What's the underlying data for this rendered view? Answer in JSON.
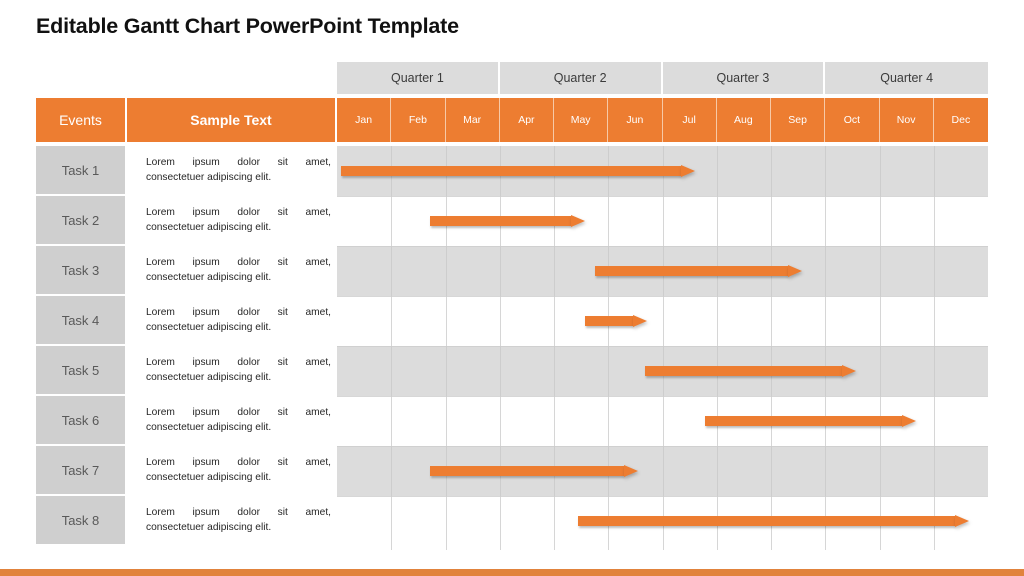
{
  "title": "Editable Gantt Chart PowerPoint Template",
  "headers": {
    "events": "Events",
    "sample_text": "Sample Text"
  },
  "colors": {
    "accent_orange": "#ed7d31",
    "bottom_bar": "#e1833c",
    "row_shaded": "#dcdcdc",
    "row_plain": "#ffffff",
    "task_cell": "#cfcfcf",
    "quarter_header": "#dcdcdc",
    "title_text": "#111111"
  },
  "chart_data": {
    "type": "bar",
    "chart_kind": "gantt",
    "title": "Editable Gantt Chart PowerPoint Template",
    "xlabel": "",
    "ylabel": "",
    "grid": true,
    "legend": "none",
    "quarters": [
      "Quarter 1",
      "Quarter 2",
      "Quarter 3",
      "Quarter 4"
    ],
    "months": [
      "Jan",
      "Feb",
      "Mar",
      "Apr",
      "May",
      "Jun",
      "Jul",
      "Aug",
      "Sep",
      "Oct",
      "Nov",
      "Dec"
    ],
    "xlim": [
      0,
      12
    ],
    "categories": [
      "Task 1",
      "Task 2",
      "Task 3",
      "Task 4",
      "Task 5",
      "Task 6",
      "Task 7",
      "Task 8"
    ],
    "tasks": [
      {
        "name": "Task 1",
        "description": "Lorem ipsum dolor sit amet, consectetuer adipiscing elit.",
        "start_month": 0.08,
        "end_month": 6.6,
        "start_label": "Jan",
        "end_label": "Jul",
        "shaded": true
      },
      {
        "name": "Task 2",
        "description": "Lorem ipsum dolor sit amet, consectetuer adipiscing elit.",
        "start_month": 1.72,
        "end_month": 4.58,
        "start_label": "Feb",
        "end_label": "May",
        "shaded": false
      },
      {
        "name": "Task 3",
        "description": "Lorem ipsum dolor sit amet, consectetuer adipiscing elit.",
        "start_month": 4.75,
        "end_month": 8.58,
        "start_label": "May",
        "end_label": "Sep",
        "shaded": true
      },
      {
        "name": "Task 4",
        "description": "Lorem ipsum dolor sit amet, consectetuer adipiscing elit.",
        "start_month": 4.58,
        "end_month": 5.72,
        "start_label": "May",
        "end_label": "Jun",
        "shaded": false
      },
      {
        "name": "Task 5",
        "description": "Lorem ipsum dolor sit amet, consectetuer adipiscing elit.",
        "start_month": 5.68,
        "end_month": 9.56,
        "start_label": "Jun",
        "end_label": "Oct",
        "shaded": true
      },
      {
        "name": "Task 6",
        "description": "Lorem ipsum dolor sit amet, consectetuer adipiscing elit.",
        "start_month": 6.79,
        "end_month": 10.67,
        "start_label": "Jul",
        "end_label": "Nov",
        "shaded": false
      },
      {
        "name": "Task 7",
        "description": "Lorem ipsum dolor sit amet, consectetuer adipiscing elit.",
        "start_month": 1.72,
        "end_month": 5.54,
        "start_label": "Feb",
        "end_label": "Jun",
        "shaded": true
      },
      {
        "name": "Task 8",
        "description": "Lorem ipsum dolor sit amet, consectetuer adipiscing elit.",
        "start_month": 4.45,
        "end_month": 11.65,
        "start_label": "May",
        "end_label": "Dec",
        "shaded": false
      }
    ]
  }
}
